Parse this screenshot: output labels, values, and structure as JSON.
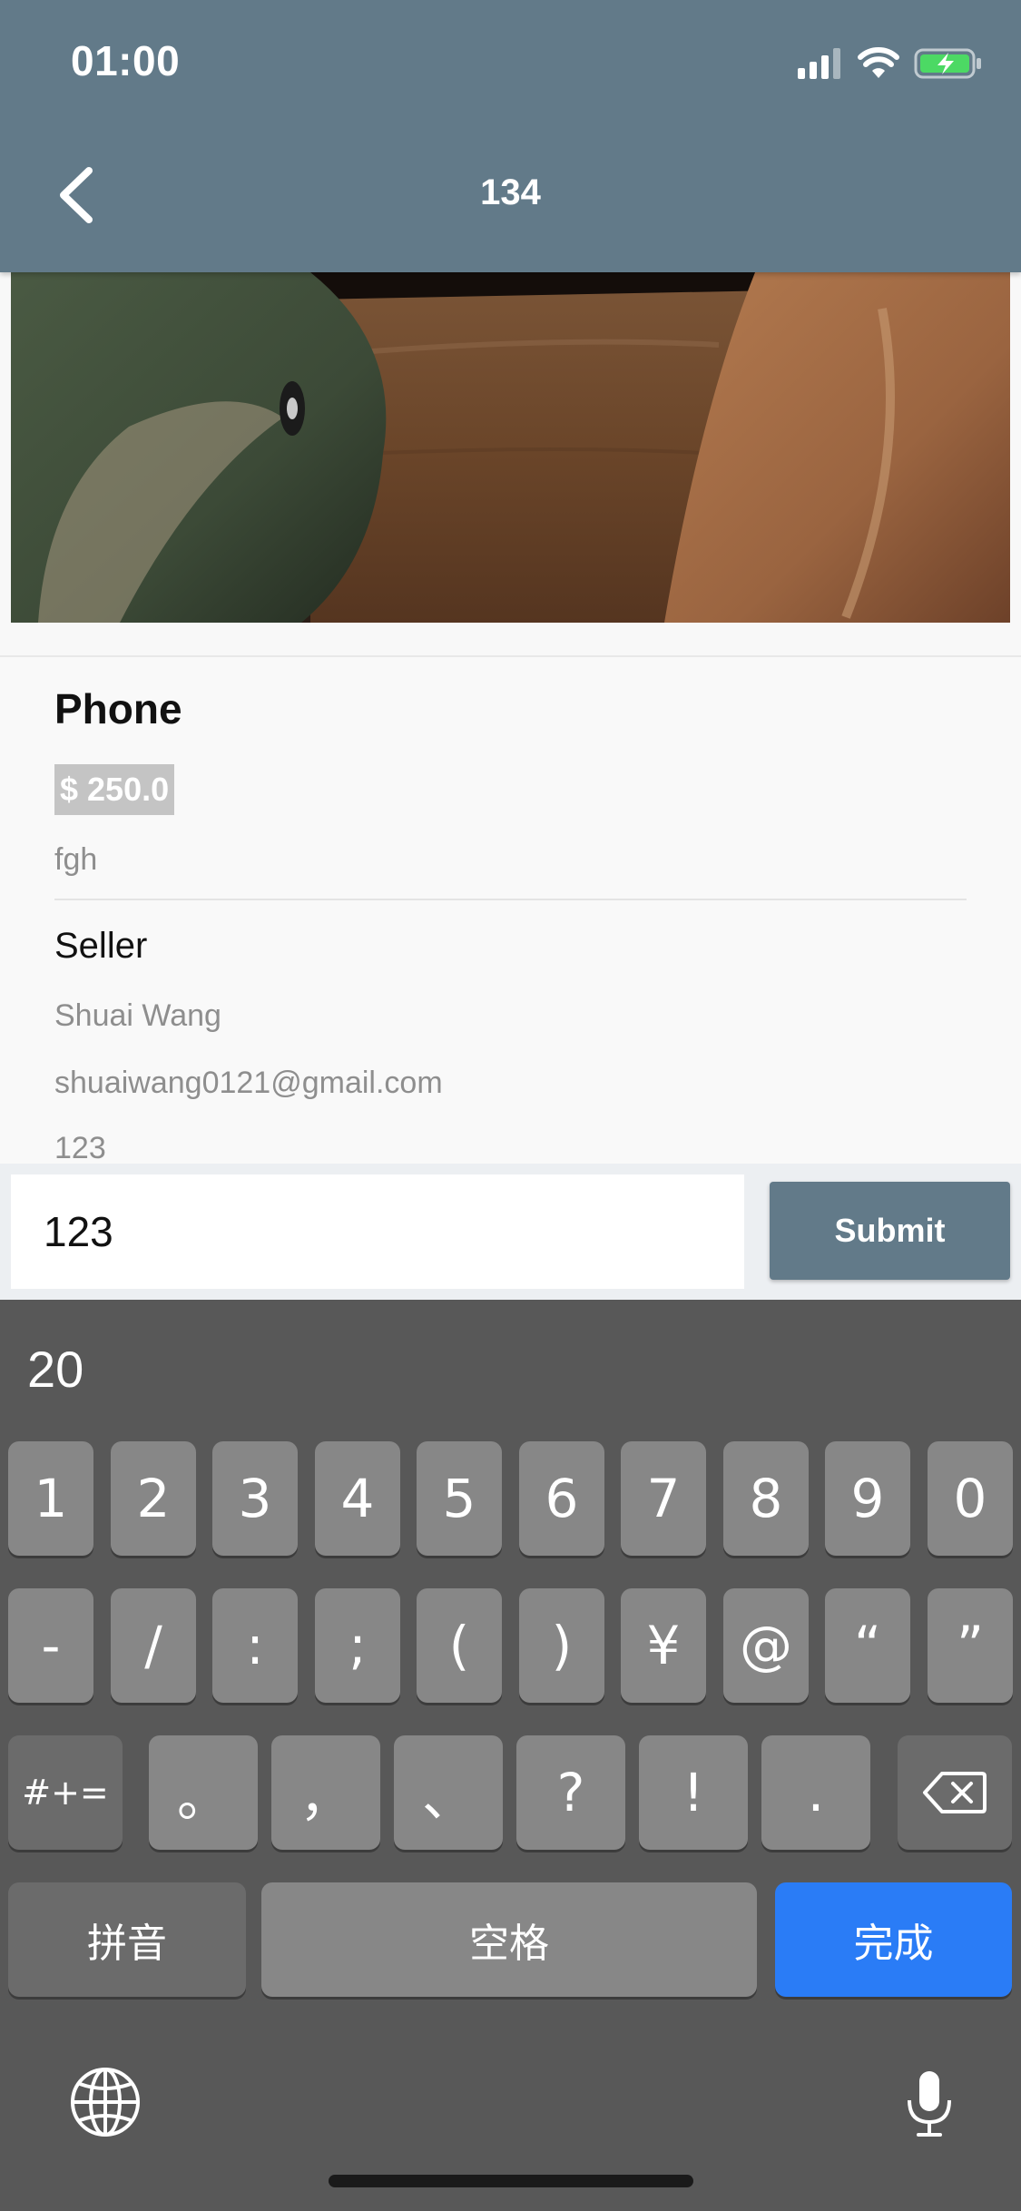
{
  "status_bar": {
    "time": "01:00"
  },
  "nav": {
    "title": "134"
  },
  "product": {
    "name": "Phone",
    "price": "$ 250.0",
    "description": "fgh"
  },
  "seller": {
    "heading": "Seller",
    "name": "Shuai Wang",
    "email": "shuaiwang0121@gmail.com",
    "phone": "123"
  },
  "comment_input": {
    "value": "123"
  },
  "submit_label": "Submit",
  "keyboard": {
    "suggestion": "20",
    "row1": [
      "1",
      "2",
      "3",
      "4",
      "5",
      "6",
      "7",
      "8",
      "9",
      "0"
    ],
    "row2": [
      "-",
      "/",
      ":",
      ";",
      "(",
      ")",
      "¥",
      "@",
      "“",
      "”"
    ],
    "row3_mode": "#+=",
    "row3": [
      "。",
      "，",
      "、",
      "?",
      "!",
      "."
    ],
    "pinyin": "拼音",
    "space": "空格",
    "done": "完成"
  },
  "colors": {
    "nav_bg": "#627a89",
    "done_key": "#2a7cf6",
    "battery": "#4cd964"
  }
}
